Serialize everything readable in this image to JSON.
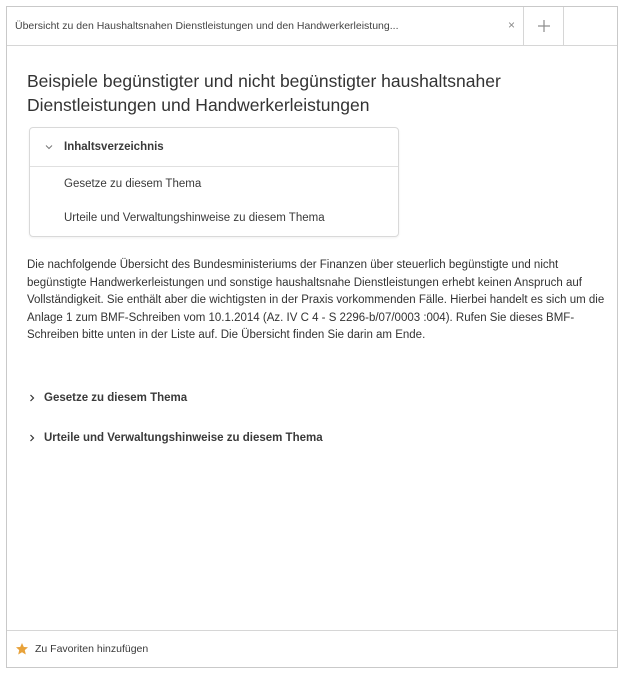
{
  "tab": {
    "title": "Übersicht zu den Haushaltsnahen Dienstleistungen und den Handwerkerleistung...",
    "close_icon": "×",
    "new_tab_icon": "plus-icon"
  },
  "page": {
    "title": "Beispiele begünstigter und nicht begünstigter haushaltsnaher Dienstleistungen und Handwerkerleistungen"
  },
  "toc": {
    "header": "Inhaltsverzeichnis",
    "items": [
      "Gesetze zu diesem Thema",
      "Urteile und Verwaltungshinweise zu diesem Thema"
    ]
  },
  "body": {
    "paragraph": "Die nachfolgende Übersicht des Bundesministeriums der Finanzen über steuerlich begünstigte und nicht begünstigte Handwerkerleistungen und sonstige haushaltsnahe Dienstleistungen erhebt keinen Anspruch auf Vollständigkeit. Sie enthält aber die wichtigsten in der Praxis vorkommenden Fälle. Hierbei handelt es sich um die Anlage 1 zum BMF-Schreiben vom 10.1.2014 (Az. IV C 4 - S 2296-b/07/0003 :004). Rufen Sie dieses BMF-Schreiben bitte unten in der Liste auf. Die Übersicht finden Sie darin am Ende."
  },
  "sections": [
    "Gesetze zu diesem Thema",
    "Urteile und Verwaltungshinweise zu diesem Thema"
  ],
  "footer": {
    "favorites_label": "Zu Favoriten hinzufügen",
    "favorites_icon_color": "#e8a23a"
  }
}
